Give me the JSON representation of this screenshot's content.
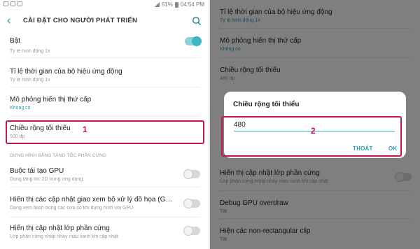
{
  "status_bar": {
    "battery": "51%",
    "time": "04:54 PM"
  },
  "app_bar": {
    "title": "CÀI ĐẶT CHO NGƯỜI PHÁT TRIỂN"
  },
  "left": {
    "master_toggle": {
      "label": "Bật",
      "on": true
    },
    "partial_sub": "Tỷ lệ hình động 1x",
    "items": [
      {
        "title": "Tỉ lệ thời gian của bộ hiệu ứng động",
        "sub": "Tỷ lệ hình động 1x"
      },
      {
        "title": "Mô phỏng hiển thị thứ cấp",
        "sub": "Không có"
      },
      {
        "title": "Chiều rộng tối thiểu",
        "sub": "500 dp"
      }
    ],
    "section_header": "DỰNG HÌNH BẰNG TĂNG TỐC PHẦN CỨNG",
    "toggles": [
      {
        "title": "Buộc tái tạo GPU",
        "sub": "Dùng tăng tốc 2D trong ứng dụng.",
        "on": false
      },
      {
        "title": "Hiển thị các cập nhật giao xem bộ xử lý đồ họa (G…",
        "sub": "Dạng xem flash trong các cửa sổ khi dựng hình với GPU",
        "on": false
      },
      {
        "title": "Hiển thị cập nhật lớp phần cứng",
        "sub": "Lớp phần cứng nhấp nháy màu xanh khi cập nhật",
        "on": false
      }
    ],
    "marker": "1"
  },
  "right": {
    "bg_items": [
      {
        "title": "Tỉ lệ thời gian của bộ hiệu ứng động",
        "sub": "Tỷ lệ hình động 1x"
      },
      {
        "title": "Mô phỏng hiển thị thứ cấp",
        "sub": "Không có"
      },
      {
        "title": "Chiều rộng tối thiểu",
        "sub": "480 dp"
      },
      {
        "title": "Hiển thị cập nhật lớp phần cứng",
        "sub": "Lớp phần cứng nhấp nháy màu xanh khi cập nhật"
      },
      {
        "title": "Debug GPU overdraw",
        "sub": "Tắt"
      },
      {
        "title": "Hiện các non-rectangular clip",
        "sub": "Tắt"
      }
    ],
    "dialog": {
      "title": "Chiều rộng tối thiểu",
      "value": "480",
      "cancel": "THOÁT",
      "ok": "OK"
    },
    "marker": "2"
  },
  "colors": {
    "accent": "#3cb5c4",
    "highlight": "#c2185b"
  }
}
